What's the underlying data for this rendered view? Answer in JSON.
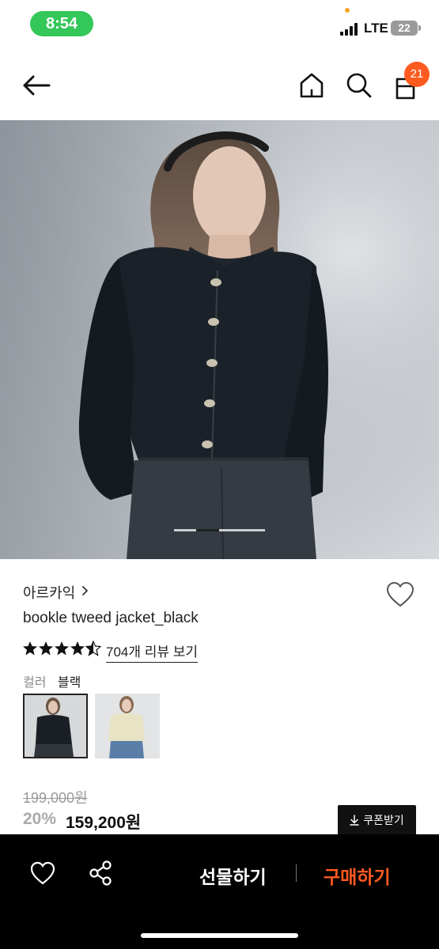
{
  "status_bar": {
    "time": "8:54",
    "network": "LTE",
    "battery": "22"
  },
  "header": {
    "cart_count": "21"
  },
  "product": {
    "brand": "아르카익",
    "name": "bookle tweed jacket_black",
    "rating": 4.5,
    "review_link": "704개 리뷰 보기",
    "color_label": "컬러",
    "color_value": "블랙",
    "color_options": [
      "black",
      "cream"
    ]
  },
  "pricing": {
    "original": "199,000원",
    "discount": "20%",
    "price": "159,200원",
    "coupon_label": "쿠폰받기"
  },
  "bottom_bar": {
    "gift_label": "선물하기",
    "buy_label": "구매하기"
  },
  "colors": {
    "accent": "#ff5a1f",
    "status_pill": "#34c759"
  }
}
